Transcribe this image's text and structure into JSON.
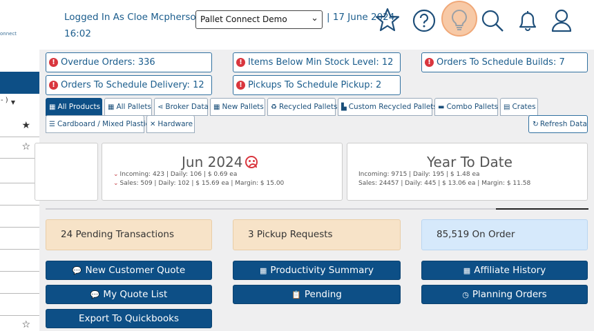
{
  "sidebar": {
    "logo_fragment": "onnect",
    "select_fragment": "- )",
    "rows": [
      {
        "star": "★"
      },
      {
        "star": "☆"
      },
      {
        "star": ""
      },
      {
        "star": ""
      },
      {
        "star": ""
      },
      {
        "star": ""
      },
      {
        "star": ""
      },
      {
        "star": ""
      },
      {
        "star": ""
      },
      {
        "star": ""
      },
      {
        "star": "☆"
      }
    ]
  },
  "header": {
    "logged_in": "Logged In As Cloe Mcpherson |",
    "time": "16:02",
    "company": "Pallet Connect Demo",
    "date": "| 17 June 2024",
    "icons": [
      "star-icon",
      "help-icon",
      "lightbulb-icon",
      "search-icon",
      "bell-icon",
      "user-icon"
    ],
    "bulb_highlight": "#f7c9a6"
  },
  "alerts": [
    {
      "label": "Overdue Orders: 336"
    },
    {
      "label": "Items Below Min Stock Level: 12"
    },
    {
      "label": "Orders To Schedule Builds: 7"
    },
    {
      "label": "Orders To Schedule Delivery: 12"
    },
    {
      "label": "Pickups To Schedule Pickup: 2"
    }
  ],
  "tabs": [
    {
      "label": "All Products",
      "icon": "grid-icon",
      "active": true
    },
    {
      "label": "All Pallets",
      "icon": "pallet-icon"
    },
    {
      "label": "Broker Data",
      "icon": "share-icon"
    },
    {
      "label": "New Pallets",
      "icon": "pallet-icon"
    },
    {
      "label": "Recycled Pallets",
      "icon": "recycle-icon"
    },
    {
      "label": "Custom Recycled Pallets",
      "icon": "chart-icon"
    },
    {
      "label": "Combo Pallets",
      "icon": "pallet-icon"
    },
    {
      "label": "Crates",
      "icon": "crate-icon"
    },
    {
      "label": "Cardboard / Mixed Plastic",
      "icon": "list-icon"
    },
    {
      "label": "Hardware",
      "icon": "tools-icon"
    }
  ],
  "refresh_label": "Refresh Data",
  "summary": {
    "month": {
      "title": "Jun 2024",
      "incoming": "Incoming: 423 | Daily: 106 | $ 0.69 ea",
      "sales": "Sales: 509 | Daily: 102 | $ 15.69 ea | Margin: $ 15.00"
    },
    "ytd": {
      "title": "Year To Date",
      "incoming": "Incoming: 9715 | Daily: 195 | $ 1.48 ea",
      "sales": "Sales: 24457 | Daily: 445 | $ 13.06 ea | Margin: $ 11.58"
    }
  },
  "progress": {
    "fraction": 0.17
  },
  "tiles": [
    {
      "label": "24 Pending Transactions",
      "kind": "warn"
    },
    {
      "label": "3 Pickup Requests",
      "kind": "warn"
    },
    {
      "label": "85,519 On Order",
      "kind": "info"
    }
  ],
  "buttons": [
    {
      "label": "New Customer Quote",
      "icon": "comment-icon"
    },
    {
      "label": "Productivity Summary",
      "icon": "table-icon"
    },
    {
      "label": "Affiliate History",
      "icon": "table-icon"
    },
    {
      "label": "My Quote List",
      "icon": "comment-icon"
    },
    {
      "label": "Pending",
      "icon": "clipboard-icon"
    },
    {
      "label": "Planning Orders",
      "icon": "clock-icon"
    },
    {
      "label": "Export To Quickbooks",
      "icon": ""
    }
  ],
  "colors": {
    "primary": "#0d4f86",
    "link": "#1a5c8c",
    "alert_red": "#d9363e",
    "warn_tile": "#f7e3c8",
    "info_tile": "#d6e9fb"
  }
}
